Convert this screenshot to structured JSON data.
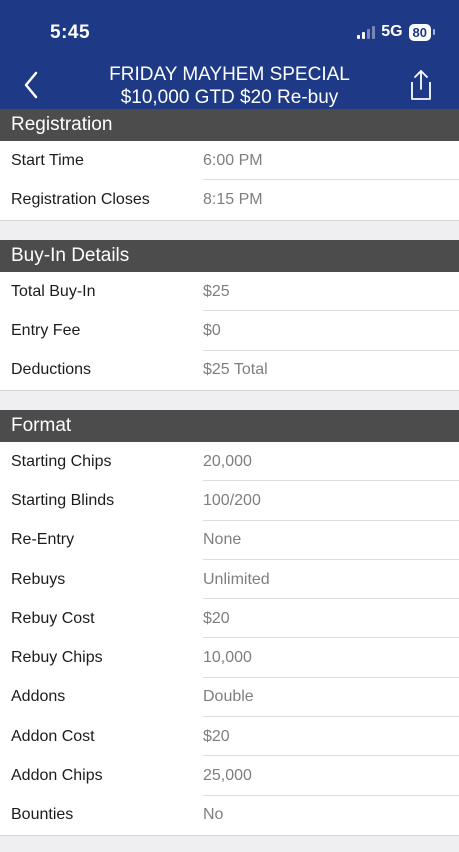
{
  "status_bar": {
    "time": "5:45",
    "network": "5G",
    "battery": "80"
  },
  "header": {
    "title_line1": "FRIDAY MAYHEM SPECIAL",
    "title_line2": "$10,000 GTD $20 Re-buy"
  },
  "sections": {
    "registration": {
      "title": "Registration",
      "rows": [
        {
          "label": "Start Time",
          "value": "6:00 PM"
        },
        {
          "label": "Registration Closes",
          "value": "8:15 PM"
        }
      ]
    },
    "buyin": {
      "title": "Buy-In Details",
      "rows": [
        {
          "label": "Total Buy-In",
          "value": "$25"
        },
        {
          "label": "Entry Fee",
          "value": "$0"
        },
        {
          "label": "Deductions",
          "value": "$25 Total"
        }
      ]
    },
    "format": {
      "title": "Format",
      "rows": [
        {
          "label": "Starting Chips",
          "value": "20,000"
        },
        {
          "label": "Starting Blinds",
          "value": "100/200"
        },
        {
          "label": "Re-Entry",
          "value": "None"
        },
        {
          "label": "Rebuys",
          "value": "Unlimited"
        },
        {
          "label": "Rebuy Cost",
          "value": "$20"
        },
        {
          "label": "Rebuy Chips",
          "value": "10,000"
        },
        {
          "label": "Addons",
          "value": "Double"
        },
        {
          "label": "Addon Cost",
          "value": "$20"
        },
        {
          "label": "Addon Chips",
          "value": "25,000"
        },
        {
          "label": "Bounties",
          "value": "No"
        }
      ]
    }
  }
}
